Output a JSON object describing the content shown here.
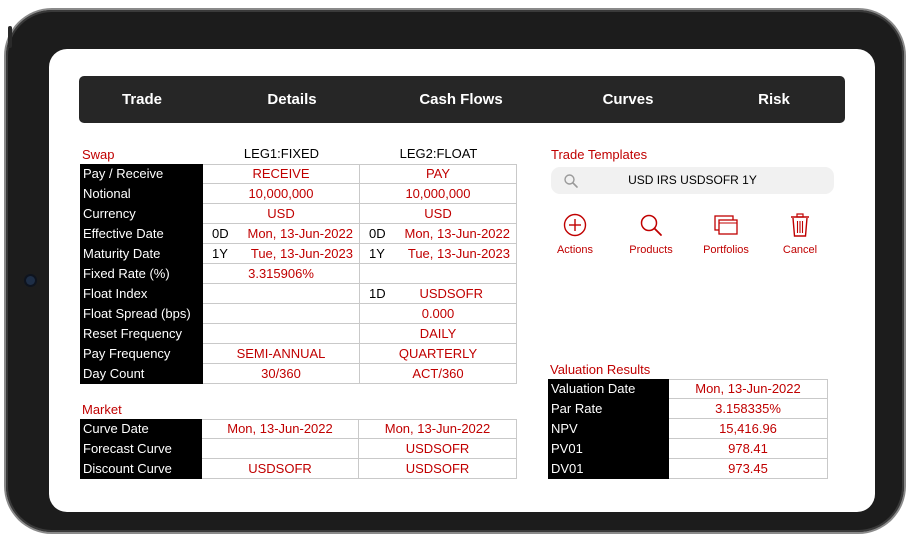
{
  "nav": {
    "tabs": [
      {
        "label": "Trade"
      },
      {
        "label": "Details"
      },
      {
        "label": "Cash Flows"
      },
      {
        "label": "Curves"
      },
      {
        "label": "Risk"
      }
    ]
  },
  "swap": {
    "title": "Swap",
    "leg1_header": "LEG1:FIXED",
    "leg2_header": "LEG2:FLOAT",
    "rows": [
      {
        "label": "Pay / Receive",
        "leg1": "RECEIVE",
        "leg2": "PAY"
      },
      {
        "label": "Notional",
        "leg1": "10,000,000",
        "leg2": "10,000,000"
      },
      {
        "label": "Currency",
        "leg1": "USD",
        "leg2": "USD"
      },
      {
        "label": "Effective Date",
        "leg1_tenor": "0D",
        "leg1": "Mon, 13-Jun-2022",
        "leg2_tenor": "0D",
        "leg2": "Mon, 13-Jun-2022"
      },
      {
        "label": "Maturity Date",
        "leg1_tenor": "1Y",
        "leg1": "Tue, 13-Jun-2023",
        "leg2_tenor": "1Y",
        "leg2": "Tue, 13-Jun-2023"
      },
      {
        "label": "Fixed Rate (%)",
        "leg1": "3.315906%",
        "leg2": ""
      },
      {
        "label": "Float Index",
        "leg1": "",
        "leg2_tenor": "1D",
        "leg2": "USDSOFR"
      },
      {
        "label": "Float Spread (bps)",
        "leg1": "",
        "leg2": "0.000"
      },
      {
        "label": "Reset Frequency",
        "leg1": "",
        "leg2": "DAILY"
      },
      {
        "label": "Pay Frequency",
        "leg1": "SEMI-ANNUAL",
        "leg2": "QUARTERLY"
      },
      {
        "label": "Day Count",
        "leg1": "30/360",
        "leg2": "ACT/360"
      }
    ]
  },
  "market": {
    "title": "Market",
    "rows": [
      {
        "label": "Curve Date",
        "leg1": "Mon, 13-Jun-2022",
        "leg2": "Mon, 13-Jun-2022"
      },
      {
        "label": "Forecast Curve",
        "leg1": "",
        "leg2": "USDSOFR"
      },
      {
        "label": "Discount Curve",
        "leg1": "USDSOFR",
        "leg2": "USDSOFR"
      }
    ]
  },
  "templates": {
    "title": "Trade Templates",
    "search_value": "USD IRS USDSOFR 1Y",
    "actions": [
      {
        "label": "Actions",
        "icon": "plus-circle-icon"
      },
      {
        "label": "Products",
        "icon": "magnifier-icon"
      },
      {
        "label": "Portfolios",
        "icon": "windows-icon"
      },
      {
        "label": "Cancel",
        "icon": "trash-icon"
      }
    ]
  },
  "valuation": {
    "title": "Valuation Results",
    "rows": [
      {
        "label": "Valuation Date",
        "value": "Mon, 13-Jun-2022"
      },
      {
        "label": "Par Rate",
        "value": "3.158335%"
      },
      {
        "label": "NPV",
        "value": "15,416.96"
      },
      {
        "label": "PV01",
        "value": "978.41"
      },
      {
        "label": "DV01",
        "value": "973.45"
      }
    ]
  },
  "colors": {
    "accent": "#c00000",
    "nav_bg": "#262626",
    "label_bg": "#000000",
    "frame": "#1c1c1c"
  }
}
